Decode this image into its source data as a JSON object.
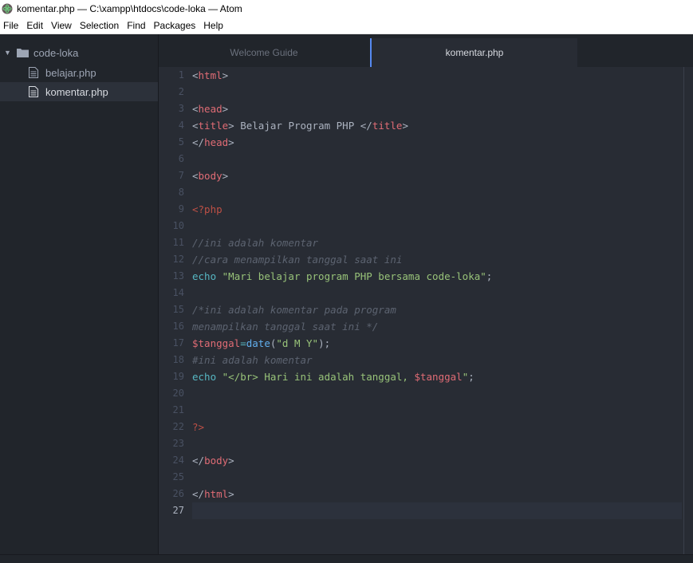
{
  "window": {
    "title": "komentar.php — C:\\xampp\\htdocs\\code-loka — Atom"
  },
  "menu": [
    "File",
    "Edit",
    "View",
    "Selection",
    "Find",
    "Packages",
    "Help"
  ],
  "sidebar": {
    "root": "code-loka",
    "files": [
      "belajar.php",
      "komentar.php"
    ],
    "selected": "komentar.php"
  },
  "tabs": [
    {
      "label": "Welcome Guide",
      "active": false
    },
    {
      "label": "komentar.php",
      "active": true
    }
  ],
  "editor": {
    "current_line": 27,
    "lines": [
      {
        "n": "1",
        "tokens": [
          [
            "punct",
            "<"
          ],
          [
            "tag",
            "html"
          ],
          [
            "punct",
            ">"
          ]
        ]
      },
      {
        "n": "2",
        "tokens": []
      },
      {
        "n": "3",
        "tokens": [
          [
            "punct",
            "<"
          ],
          [
            "tag",
            "head"
          ],
          [
            "punct",
            ">"
          ]
        ]
      },
      {
        "n": "4",
        "tokens": [
          [
            "punct",
            "<"
          ],
          [
            "tag",
            "title"
          ],
          [
            "punct",
            "> "
          ],
          [
            "plain",
            "Belajar Program PHP "
          ],
          [
            "punct",
            "</"
          ],
          [
            "tag",
            "title"
          ],
          [
            "punct",
            ">"
          ]
        ]
      },
      {
        "n": "5",
        "tokens": [
          [
            "punct",
            "</"
          ],
          [
            "tag",
            "head"
          ],
          [
            "punct",
            ">"
          ]
        ]
      },
      {
        "n": "6",
        "tokens": []
      },
      {
        "n": "7",
        "tokens": [
          [
            "punct",
            "<"
          ],
          [
            "tag",
            "body"
          ],
          [
            "punct",
            ">"
          ]
        ]
      },
      {
        "n": "8",
        "tokens": []
      },
      {
        "n": "9",
        "tokens": [
          [
            "php",
            "<?php"
          ]
        ]
      },
      {
        "n": "10",
        "tokens": []
      },
      {
        "n": "11",
        "tokens": [
          [
            "comment",
            "//ini adalah komentar"
          ]
        ]
      },
      {
        "n": "12",
        "tokens": [
          [
            "comment",
            "//cara menampilkan tanggal saat ini"
          ]
        ]
      },
      {
        "n": "13",
        "tokens": [
          [
            "kw",
            "echo "
          ],
          [
            "str",
            "\"Mari belajar program PHP bersama code-loka\""
          ],
          [
            "plain",
            ";"
          ]
        ]
      },
      {
        "n": "14",
        "tokens": []
      },
      {
        "n": "15",
        "tokens": [
          [
            "comment",
            "/*ini adalah komentar pada program"
          ]
        ]
      },
      {
        "n": "16",
        "tokens": [
          [
            "comment",
            "menampilkan tanggal saat ini */"
          ]
        ]
      },
      {
        "n": "17",
        "tokens": [
          [
            "var",
            "$tanggal"
          ],
          [
            "op",
            "="
          ],
          [
            "fn",
            "date"
          ],
          [
            "plain",
            "("
          ],
          [
            "str",
            "\"d M Y\""
          ],
          [
            "plain",
            ");"
          ]
        ]
      },
      {
        "n": "18",
        "tokens": [
          [
            "comment",
            "#ini adalah komentar"
          ]
        ]
      },
      {
        "n": "19",
        "tokens": [
          [
            "kw",
            "echo "
          ],
          [
            "str",
            "\"</br> Hari ini adalah tanggal, "
          ],
          [
            "var",
            "$tanggal"
          ],
          [
            "str",
            "\""
          ],
          [
            "plain",
            ";"
          ]
        ]
      },
      {
        "n": "20",
        "tokens": []
      },
      {
        "n": "21",
        "tokens": []
      },
      {
        "n": "22",
        "tokens": [
          [
            "php",
            "?>"
          ]
        ]
      },
      {
        "n": "23",
        "tokens": []
      },
      {
        "n": "24",
        "tokens": [
          [
            "punct",
            "</"
          ],
          [
            "tag",
            "body"
          ],
          [
            "punct",
            ">"
          ]
        ]
      },
      {
        "n": "25",
        "tokens": []
      },
      {
        "n": "26",
        "tokens": [
          [
            "punct",
            "</"
          ],
          [
            "tag",
            "html"
          ],
          [
            "punct",
            ">"
          ]
        ]
      },
      {
        "n": "27",
        "tokens": []
      }
    ]
  }
}
